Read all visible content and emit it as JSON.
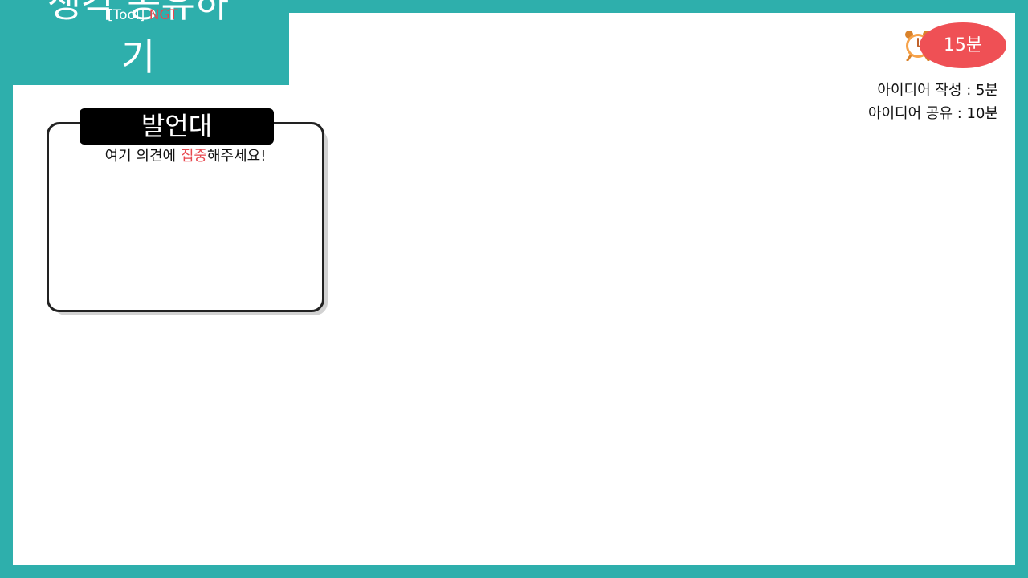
{
  "title": {
    "line1": "생각 공유하",
    "line2": "기"
  },
  "tool_tag": {
    "prefix": "[Tool]",
    "name": "NGT"
  },
  "timer": {
    "total": "15분",
    "lines": [
      "아이디어 작성 : 5분",
      "아이디어 공유 : 10분"
    ]
  },
  "podium": {
    "label": "발언대",
    "hint_before": "여기 의견에 ",
    "hint_accent": "집중",
    "hint_after": "해주세요!"
  },
  "colors": {
    "frame": "#2eafac",
    "accent": "#ef5055",
    "label_bg": "#000000"
  },
  "icons": {
    "timer": "alarm-clock-icon"
  }
}
